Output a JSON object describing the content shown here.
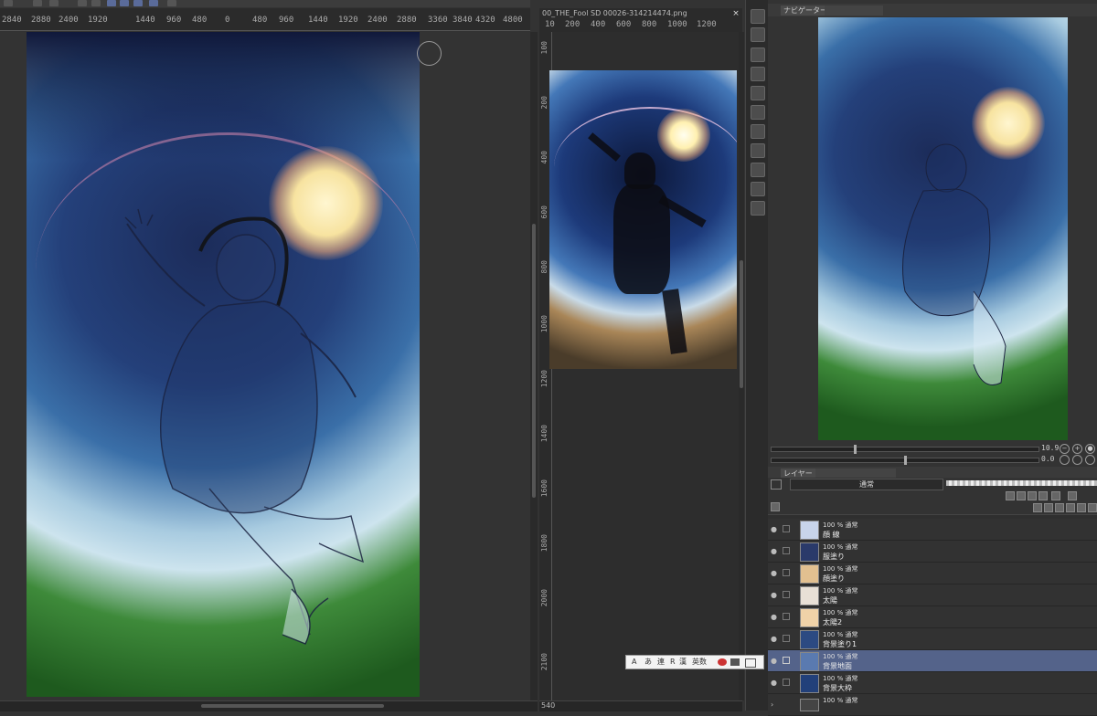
{
  "main_canvas": {
    "ruler_labels": [
      "2840",
      "2880",
      "2400",
      "1920",
      "1440",
      "960",
      "480",
      "0",
      "480",
      "960",
      "1440",
      "1920",
      "2400",
      "2880",
      "3360",
      "3840",
      "4320",
      "4800"
    ]
  },
  "reference_window": {
    "tab_title": "00_THE_Fool SD 00026-314214474.png",
    "close_symbol": "×",
    "ruler_h_labels": [
      "10",
      "200",
      "400",
      "600",
      "800",
      "1000",
      "1200"
    ],
    "ruler_v_labels": [
      "100",
      "200",
      "400",
      "600",
      "800",
      "1000",
      "1200",
      "1400",
      "1600",
      "1800",
      "2000",
      "2100"
    ],
    "status_value": "540"
  },
  "navigator": {
    "tab_label": "ナビゲーター",
    "zoom_value": "10.9",
    "rotation_value": "0.0"
  },
  "layer_panel": {
    "tab_label": "レイヤー",
    "blend_mode": "通常",
    "layers": [
      {
        "mode": "100 % 通常",
        "name": "顔 線",
        "thumb": "#c8d4ea",
        "selected": false,
        "folder": false
      },
      {
        "mode": "100 % 通常",
        "name": "服塗り",
        "thumb": "#2a3a6a",
        "selected": false,
        "folder": false
      },
      {
        "mode": "100 % 通常",
        "name": "顔塗り",
        "thumb": "#e2c090",
        "selected": false,
        "folder": false
      },
      {
        "mode": "100 % 通常",
        "name": "太陽",
        "thumb": "#e8e0d6",
        "selected": false,
        "folder": false
      },
      {
        "mode": "100 % 通常",
        "name": "太陽2",
        "thumb": "#f0d2a8",
        "selected": false,
        "folder": false
      },
      {
        "mode": "100 % 通常",
        "name": "背景塗り1",
        "thumb": "#2c4a82",
        "selected": false,
        "folder": false
      },
      {
        "mode": "100 % 通常",
        "name": "背景地面",
        "thumb": "#5a7ab0",
        "selected": true,
        "folder": false
      },
      {
        "mode": "100 % 通常",
        "name": "背景大枠",
        "thumb": "#22407a",
        "selected": false,
        "folder": false
      },
      {
        "mode": "100 % 通常",
        "name": "",
        "thumb": "#444444",
        "selected": false,
        "folder": true
      }
    ]
  },
  "text_palette": {
    "items": [
      "A",
      "あ",
      "連",
      "R",
      "漢",
      "英数"
    ]
  },
  "colors": {
    "accent_selected": "#54638a",
    "panel_bg": "#333333"
  }
}
